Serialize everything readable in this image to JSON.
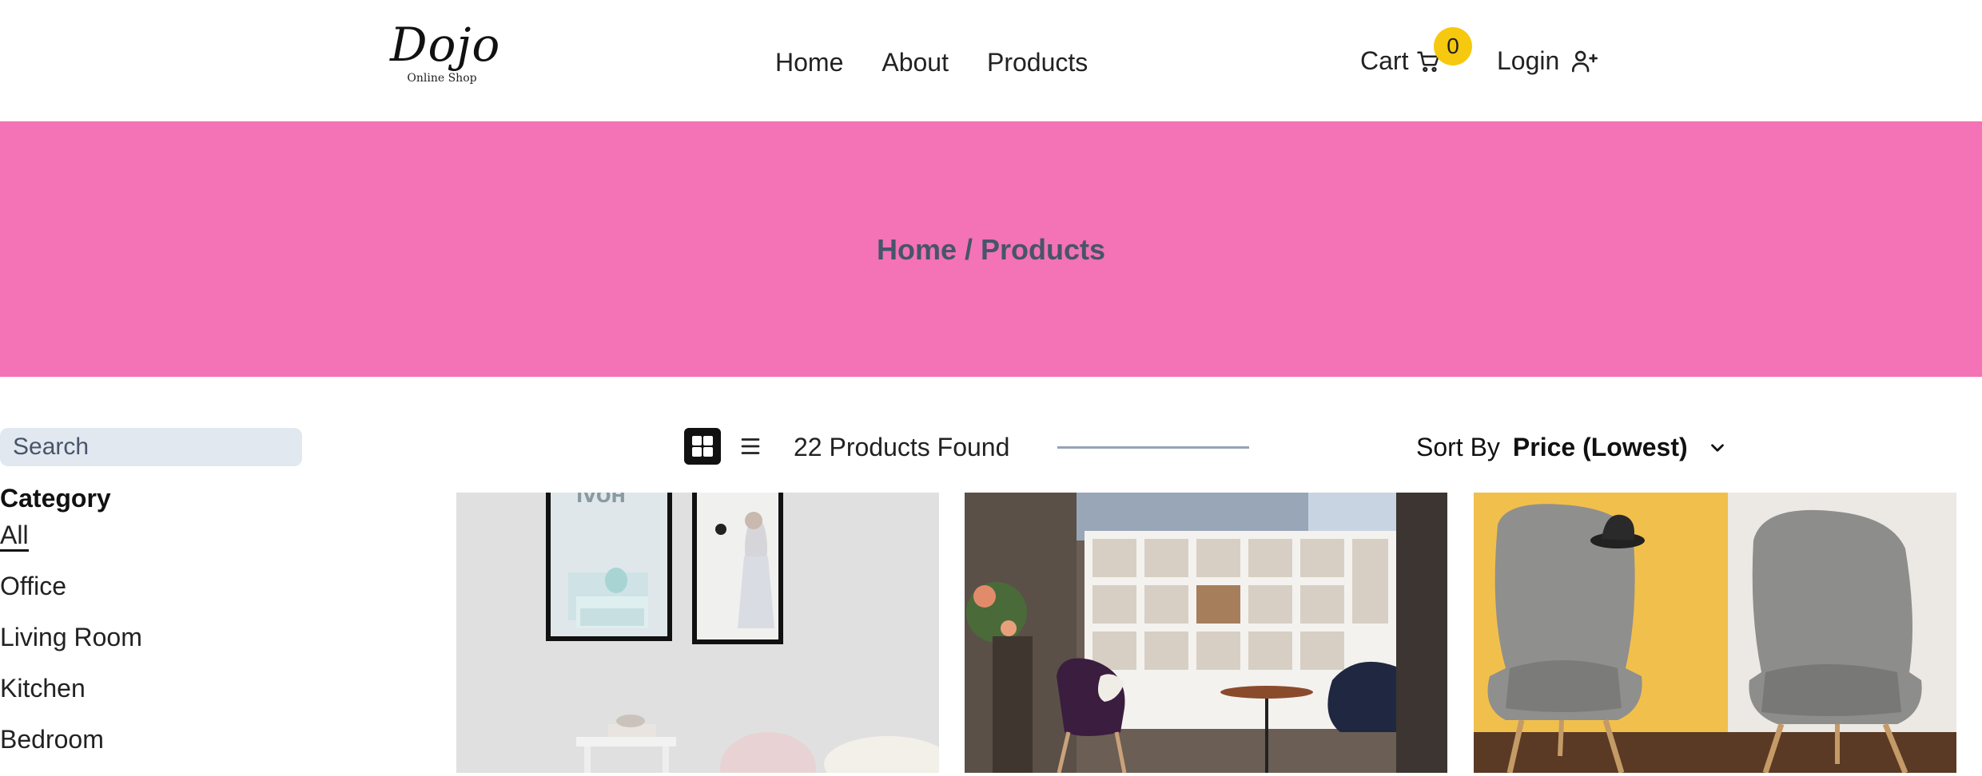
{
  "header": {
    "logo_main": "Dojo",
    "logo_sub": "Online Shop",
    "nav": [
      {
        "label": "Home"
      },
      {
        "label": "About"
      },
      {
        "label": "Products"
      }
    ],
    "cart_label": "Cart",
    "cart_count": "0",
    "login_label": "Login"
  },
  "hero": {
    "breadcrumb": "Home / Products",
    "background_color": "#f472b6"
  },
  "sidebar": {
    "search_placeholder": "Search",
    "category_title": "Category",
    "categories": [
      {
        "label": "All",
        "active": true
      },
      {
        "label": "Office"
      },
      {
        "label": "Living Room"
      },
      {
        "label": "Kitchen"
      },
      {
        "label": "Bedroom"
      }
    ]
  },
  "toolbar": {
    "products_found": "22 Products Found",
    "sort_label": "Sort By",
    "sort_value": "Price (Lowest)",
    "view_modes": [
      "grid-icon",
      "list-icon"
    ],
    "active_view": "grid"
  },
  "products": [
    {
      "image": "living-room-frames-photo"
    },
    {
      "image": "office-shelves-chairs-photo"
    },
    {
      "image": "grey-armchairs-photo"
    }
  ],
  "colors": {
    "accent_badge": "#f6c90e",
    "hero": "#f472b6",
    "search_bg": "#e2e8f0"
  }
}
